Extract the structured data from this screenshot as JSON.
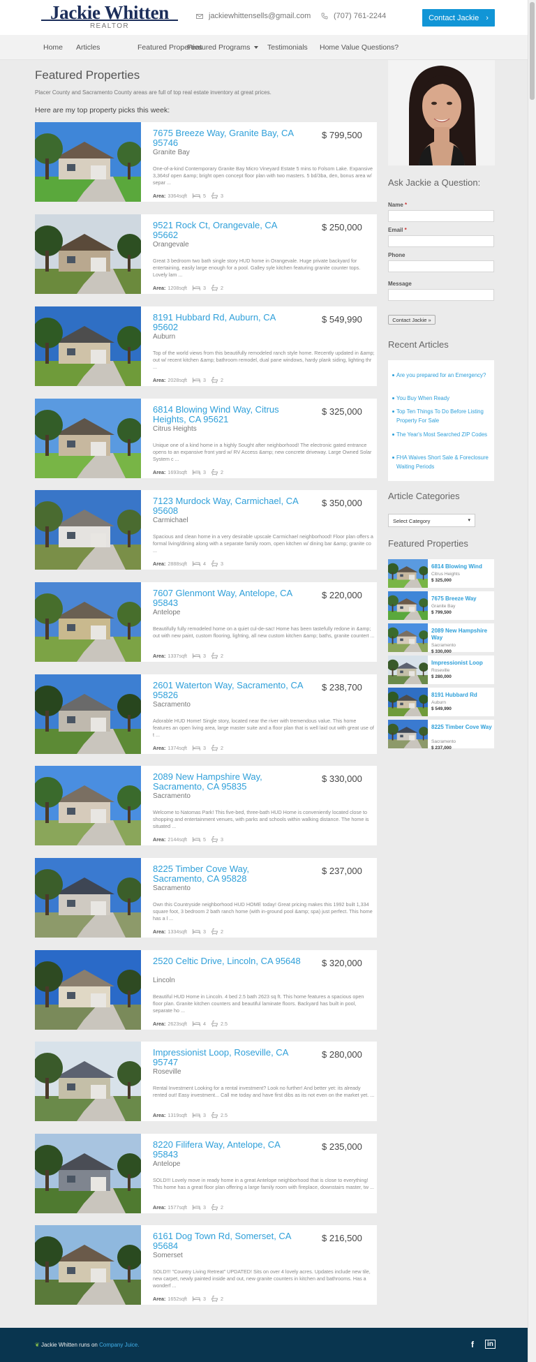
{
  "brand": {
    "name": "Jackie Whitten",
    "tagline": "REALTOR"
  },
  "contact": {
    "email": "jackiewhittensells@gmail.com",
    "phone": "(707) 761-2244",
    "cta": "Contact Jackie"
  },
  "nav": [
    "Home",
    "Articles",
    "Featured Properties",
    "Featured Programs",
    "Testimonials",
    "Home Value Questions?"
  ],
  "main": {
    "title": "Featured Properties",
    "intro": "Placer County and Sacramento County areas are full of top real estate inventory at great prices.",
    "picks": "Here are my top property picks this week:",
    "area_label": "Area:"
  },
  "listings": [
    {
      "address": "7675 Breeze Way, Granite Bay, CA 95746",
      "price": "$ 799,500",
      "city": "Granite Bay",
      "desc": "One-of-a-kind Contemporary Granite Bay Micro Vineyard Estate 5 mins to Folsom Lake. Expansive 3,364sf open &amp; bright open concept floor plan with two masters. 5 bd/3ba, den, bonus area w/ separ ...",
      "area": "3364sqft",
      "beds": "5",
      "baths": "3"
    },
    {
      "address": "9521 Rock Ct, Orangevale, CA 95662",
      "price": "$ 250,000",
      "city": "Orangevale",
      "desc": "Great 3 bedroom two bath single story HUD home in Orangevale. Huge private backyard for entertaining, easily large enough for a pool. Galley syle kitchen featuring granite counter tops. Lovely lam ...",
      "area": "1208sqft",
      "beds": "3",
      "baths": "2"
    },
    {
      "address": "8191 Hubbard Rd, Auburn, CA 95602",
      "price": "$ 549,990",
      "city": "Auburn",
      "desc": "Top of the world views from this beautifully remodeled ranch style home. Recently updated in &amp; out w/ recent kitchen &amp; bathroom remodel, dual pane windows, hardy plank siding, lighting thr ...",
      "area": "2028sqft",
      "beds": "3",
      "baths": "2"
    },
    {
      "address": "6814 Blowing Wind Way, Citrus Heights, CA 95621",
      "price": "$ 325,000",
      "city": "Citrus Heights",
      "desc": "Unique one of a kind home in a highly Sought after neighborhood! The electronic gated entrance opens to an expansive front yard w/ RV Access &amp; new concrete driveway. Large Owned Solar System c ...",
      "area": "1693sqft",
      "beds": "3",
      "baths": "2"
    },
    {
      "address": "7123 Murdock Way, Carmichael, CA 95608",
      "price": "$ 350,000",
      "city": "Carmichael",
      "desc": "Spacious and clean home in a very desirable upscale Carmichael neighborhood! Floor plan offers a formal living/dining along with a separate family room, open kitchen w/ dining bar &amp; granite co ...",
      "area": "2888sqft",
      "beds": "4",
      "baths": "3"
    },
    {
      "address": "7607 Glenmont Way, Antelope, CA 95843",
      "price": "$ 220,000",
      "city": "Antelope",
      "desc": "Beautifully fully remodeled home on a quiet cul-de-sac! Home has been tastefully redone in &amp; out with new paint, custom flooring, lighting, all new custom kitchen &amp; baths, granite countert ...",
      "area": "1337sqft",
      "beds": "3",
      "baths": "2"
    },
    {
      "address": "2601 Waterton Way, Sacramento, CA 95826",
      "price": "$ 238,700",
      "city": "Sacramento",
      "desc": "Adorable HUD Home! Single story, located near the river with tremendous value. This home features an open living area, large master suite and a floor plan that is well laid out with great use of t ...",
      "area": "1374sqft",
      "beds": "3",
      "baths": "2"
    },
    {
      "address": "2089 New Hampshire Way, Sacramento, CA 95835",
      "price": "$ 330,000",
      "city": "Sacramento",
      "desc": "Welcome to Natomas Park! This five-bed, three-bath HUD Home is conveniently located close to shopping and entertainment venues, with parks and schools within walking distance. The home is situated ...",
      "area": "2144sqft",
      "beds": "5",
      "baths": "3"
    },
    {
      "address": "8225 Timber Cove Way, Sacramento, CA 95828",
      "price": "$ 237,000",
      "city": "Sacramento",
      "desc": "Own this Countryside neighborhood HUD HOME today! Great pricing makes this 1992 built 1,334 square foot, 3 bedroom 2 bath ranch home (with in-ground pool &amp; spa) just perfect. This home has a l ...",
      "area": "1334sqft",
      "beds": "3",
      "baths": "2"
    },
    {
      "address": "2520 Celtic Drive, Lincoln, CA 95648",
      "price": "$ 320,000",
      "city": "Lincoln",
      "desc": "Beautiful HUD Home in Lincoln. 4 bed 2.5 bath 2623 sq ft. This home features a spacious open floor plan. Granite kitchen counters and beautiful laminate floors. Backyard has built in pool, separate ho ...",
      "area": "2623sqft",
      "beds": "4",
      "baths": "2.5"
    },
    {
      "address": "Impressionist Loop, Roseville, CA 95747",
      "price": "$ 280,000",
      "city": "Roseville",
      "desc": "Rental Investment Looking for a rental investment? Look no further! And better yet: its already rented out! Easy investment... Call me today and have first dibs as its not even on the market yet. ...",
      "area": "1319sqft",
      "beds": "3",
      "baths": "2.5"
    },
    {
      "address": "8220 Filifera Way, Antelope, CA 95843",
      "price": "$ 235,000",
      "city": "Antelope",
      "desc": "SOLD!!! Lovely move in ready home in a great Antelope neighborhood that is close to everything! This home has a great floor plan offering a large family room with fireplace, downstairs master, tw ...",
      "area": "1577sqft",
      "beds": "3",
      "baths": "2"
    },
    {
      "address": "6161 Dog Town Rd, Somerset, CA 95684",
      "price": "$ 216,500",
      "city": "Somerset",
      "desc": "SOLD!!! \"Country Living Retreat\" UPDATED! Sits on over 4 lovely acres. Updates include new tile, new carpet, newly painted inside and out, new granite counters in kitchen and bathrooms. Has a wonderf ...",
      "area": "1652sqft",
      "beds": "3",
      "baths": "2"
    }
  ],
  "sidebar": {
    "ask_title": "Ask Jackie a Question:",
    "name_label": "Name",
    "email_label": "Email",
    "phone_label": "Phone",
    "message_label": "Message",
    "required": "*",
    "submit": "Contact Jackie »",
    "recent_title": "Recent Articles",
    "articles": [
      "Are you prepared for an Emergency?",
      "You Buy When Ready",
      "Top Ten Things To Do Before Listing Property For Sale",
      "The Year's Most Searched ZIP Codes",
      "FHA Waives Short Sale & Foreclosure Waiting Periods"
    ],
    "categories_title": "Article Categories",
    "category_select": "Select Category",
    "featured_title": "Featured Properties",
    "featured": [
      {
        "name": "6814 Blowing Wind",
        "city": "Citrus Heights",
        "price": "$ 325,000"
      },
      {
        "name": "7675 Breeze Way",
        "city": "Granite Bay",
        "price": "$ 799,500"
      },
      {
        "name": "2089 New Hampshire Way",
        "city": "Sacramento",
        "price": "$ 330,000"
      },
      {
        "name": "Impressionist Loop",
        "city": "Roseville",
        "price": "$ 280,000"
      },
      {
        "name": "8191 Hubbard Rd",
        "city": "Auburn",
        "price": "$ 549,990"
      },
      {
        "name": "8225 Timber Cove Way",
        "city": "Sacramento",
        "price": "$ 237,000"
      }
    ]
  },
  "footer": {
    "text": "Jackie Whitten runs on",
    "link": "Company Juice.",
    "social": [
      "f",
      "in"
    ]
  },
  "colors": {
    "accent": "#1195d6",
    "link": "#2e9fd9",
    "brand": "#1c2e5a",
    "footer": "#09354f"
  }
}
